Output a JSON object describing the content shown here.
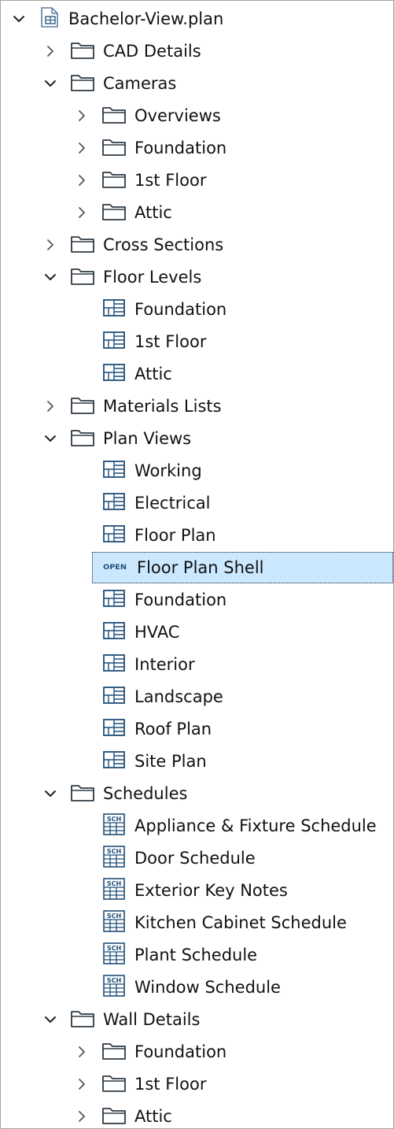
{
  "tree": [
    {
      "label": "Bachelor-View.plan",
      "icon": "plan-file-icon",
      "expander": "expanded",
      "depth": 0
    },
    {
      "label": "CAD Details",
      "icon": "folder-icon",
      "expander": "collapsed",
      "depth": 1
    },
    {
      "label": "Cameras",
      "icon": "folder-icon",
      "expander": "expanded",
      "depth": 1
    },
    {
      "label": "Overviews",
      "icon": "folder-icon",
      "expander": "collapsed",
      "depth": 2
    },
    {
      "label": "Foundation",
      "icon": "folder-icon",
      "expander": "collapsed",
      "depth": 2
    },
    {
      "label": "1st Floor",
      "icon": "folder-icon",
      "expander": "collapsed",
      "depth": 2
    },
    {
      "label": "Attic",
      "icon": "folder-icon",
      "expander": "collapsed",
      "depth": 2
    },
    {
      "label": "Cross Sections",
      "icon": "folder-icon",
      "expander": "collapsed",
      "depth": 1
    },
    {
      "label": "Floor Levels",
      "icon": "folder-icon",
      "expander": "expanded",
      "depth": 1
    },
    {
      "label": "Foundation",
      "icon": "plan-view-icon",
      "expander": "none",
      "depth": 2
    },
    {
      "label": "1st Floor",
      "icon": "plan-view-icon",
      "expander": "none",
      "depth": 2
    },
    {
      "label": "Attic",
      "icon": "plan-view-icon",
      "expander": "none",
      "depth": 2
    },
    {
      "label": "Materials Lists",
      "icon": "folder-icon",
      "expander": "collapsed",
      "depth": 1
    },
    {
      "label": "Plan Views",
      "icon": "folder-icon",
      "expander": "expanded",
      "depth": 1
    },
    {
      "label": " Working",
      "icon": "plan-view-icon",
      "expander": "none",
      "depth": 2
    },
    {
      "label": "Electrical",
      "icon": "plan-view-icon",
      "expander": "none",
      "depth": 2
    },
    {
      "label": "Floor Plan",
      "icon": "plan-view-icon",
      "expander": "none",
      "depth": 2
    },
    {
      "label": "Floor Plan Shell",
      "icon": "open-badge-icon",
      "badge": "OPEN",
      "expander": "none",
      "depth": 2,
      "selected": true
    },
    {
      "label": "Foundation",
      "icon": "plan-view-icon",
      "expander": "none",
      "depth": 2
    },
    {
      "label": "HVAC",
      "icon": "plan-view-icon",
      "expander": "none",
      "depth": 2
    },
    {
      "label": "Interior",
      "icon": "plan-view-icon",
      "expander": "none",
      "depth": 2
    },
    {
      "label": "Landscape",
      "icon": "plan-view-icon",
      "expander": "none",
      "depth": 2
    },
    {
      "label": "Roof Plan",
      "icon": "plan-view-icon",
      "expander": "none",
      "depth": 2
    },
    {
      "label": "Site Plan",
      "icon": "plan-view-icon",
      "expander": "none",
      "depth": 2
    },
    {
      "label": "Schedules",
      "icon": "folder-icon",
      "expander": "expanded",
      "depth": 1
    },
    {
      "label": "Appliance & Fixture Schedule",
      "icon": "schedule-icon",
      "badge": "SCH",
      "expander": "none",
      "depth": 2
    },
    {
      "label": "Door Schedule",
      "icon": "schedule-icon",
      "badge": "SCH",
      "expander": "none",
      "depth": 2
    },
    {
      "label": "Exterior Key Notes",
      "icon": "schedule-icon",
      "badge": "SCH",
      "expander": "none",
      "depth": 2
    },
    {
      "label": "Kitchen Cabinet Schedule",
      "icon": "schedule-icon",
      "badge": "SCH",
      "expander": "none",
      "depth": 2
    },
    {
      "label": "Plant Schedule",
      "icon": "schedule-icon",
      "badge": "SCH",
      "expander": "none",
      "depth": 2
    },
    {
      "label": "Window Schedule",
      "icon": "schedule-icon",
      "badge": "SCH",
      "expander": "none",
      "depth": 2
    },
    {
      "label": "Wall Details",
      "icon": "folder-icon",
      "expander": "expanded",
      "depth": 1
    },
    {
      "label": "Foundation",
      "icon": "folder-icon",
      "expander": "collapsed",
      "depth": 2
    },
    {
      "label": "1st Floor",
      "icon": "folder-icon",
      "expander": "collapsed",
      "depth": 2
    },
    {
      "label": "Attic",
      "icon": "folder-icon",
      "expander": "collapsed",
      "depth": 2
    }
  ],
  "colors": {
    "selection_bg": "#cce8ff",
    "folder_stroke": "#2e3a44",
    "icon_stroke": "#1f4e79",
    "chevron": "#555555"
  }
}
